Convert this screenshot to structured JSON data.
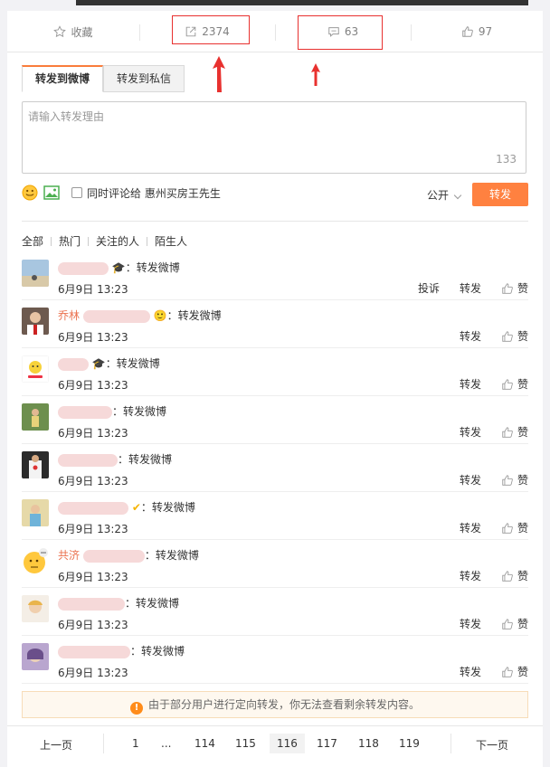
{
  "actions": {
    "favorite_label": "收藏",
    "repost_count": "2374",
    "comment_count": "63",
    "like_count": "97"
  },
  "tabs": [
    {
      "label": "转发到微博",
      "active": true
    },
    {
      "label": "转发到私信",
      "active": false
    }
  ],
  "composer": {
    "placeholder": "请输入转发理由",
    "counter": "133",
    "also_comment_label": "同时评论给 惠州买房王先生",
    "visibility": "公开",
    "submit_label": "转发"
  },
  "filters": [
    "全部",
    "热门",
    "关注的人",
    "陌生人"
  ],
  "reposts": [
    {
      "nick": "",
      "action": "转发微博",
      "time": "6月9日  13:23",
      "ops": [
        "投诉",
        "转发",
        "赞"
      ],
      "badge": "graduate"
    },
    {
      "nick": "乔林",
      "action": "转发微博",
      "time": "6月9日  13:23",
      "ops": [
        "转发",
        "赞"
      ],
      "badge": "emoji"
    },
    {
      "nick": "",
      "action": "转发微博",
      "time": "6月9日  13:23",
      "ops": [
        "转发",
        "赞"
      ],
      "badge": "graduate"
    },
    {
      "nick": "",
      "action": "转发微博",
      "time": "6月9日  13:23",
      "ops": [
        "转发",
        "赞"
      ],
      "badge": ""
    },
    {
      "nick": "",
      "action": "转发微博",
      "time": "6月9日  13:23",
      "ops": [
        "转发",
        "赞"
      ],
      "badge": ""
    },
    {
      "nick": "",
      "action": "转发微博",
      "time": "6月9日  13:23",
      "ops": [
        "转发",
        "赞"
      ],
      "badge": "check"
    },
    {
      "nick": "共济",
      "action": "转发微博",
      "time": "6月9日  13:23",
      "ops": [
        "转发",
        "赞"
      ],
      "badge": ""
    },
    {
      "nick": "",
      "action": "转发微博",
      "time": "6月9日  13:23",
      "ops": [
        "转发",
        "赞"
      ],
      "badge": ""
    },
    {
      "nick": "",
      "action": "转发微博",
      "time": "6月9日  13:23",
      "ops": [
        "转发",
        "赞"
      ],
      "badge": ""
    }
  ],
  "notice": "由于部分用户进行定向转发，你无法查看剩余转发内容。",
  "pagination": {
    "prev": "上一页",
    "next": "下一页",
    "pages": [
      "1",
      "...",
      "114",
      "115",
      "116",
      "117",
      "118",
      "119"
    ],
    "current": "116"
  },
  "colors": {
    "accent": "#ff8140",
    "highlight_box": "#e8312f",
    "nick": "#eb7350"
  }
}
